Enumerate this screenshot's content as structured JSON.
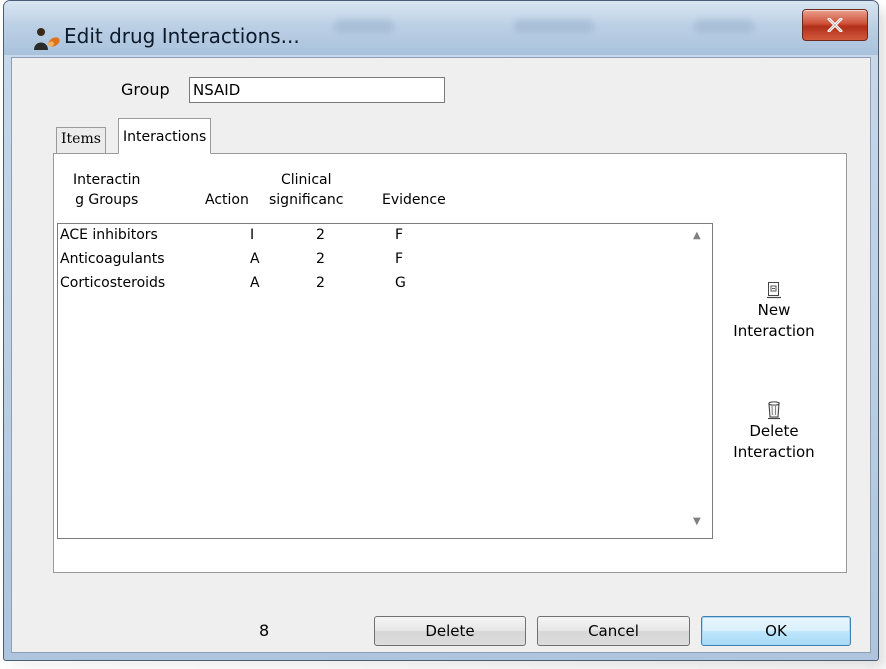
{
  "window": {
    "title": "Edit drug Interactions..."
  },
  "form": {
    "group_label": "Group",
    "group_value": "NSAID"
  },
  "tabs": [
    {
      "label": "Items",
      "active": false
    },
    {
      "label": "Interactions",
      "active": true
    }
  ],
  "table": {
    "headers": {
      "groups_line1": "Interactin",
      "groups_line2": "g Groups",
      "action": "Action",
      "clinical_line1": "Clinical",
      "clinical_line2": "significanc",
      "evidence": "Evidence"
    },
    "rows": [
      {
        "group": "ACE inhibitors",
        "action": "I",
        "significance": "2",
        "evidence": "F"
      },
      {
        "group": "Anticoagulants",
        "action": "A",
        "significance": "2",
        "evidence": "F"
      },
      {
        "group": "Corticosteroids",
        "action": "A",
        "significance": "2",
        "evidence": "G"
      }
    ]
  },
  "side_buttons": {
    "new_line1": "New",
    "new_line2": "Interaction",
    "delete_line1": "Delete",
    "delete_line2": "Interaction"
  },
  "footer": {
    "count": "8",
    "delete_label": "Delete",
    "cancel_label": "Cancel",
    "ok_label": "OK"
  },
  "icons": {
    "app": "pill-person-icon",
    "close": "close-x-icon",
    "new": "new-document-icon",
    "delete": "trash-can-icon",
    "scroll_up": "triangle-up-icon",
    "scroll_down": "triangle-down-icon"
  },
  "colors": {
    "title_bar": "#bcd0e5",
    "close_button": "#c8442b",
    "ok_button_border": "#3c7fb1"
  }
}
